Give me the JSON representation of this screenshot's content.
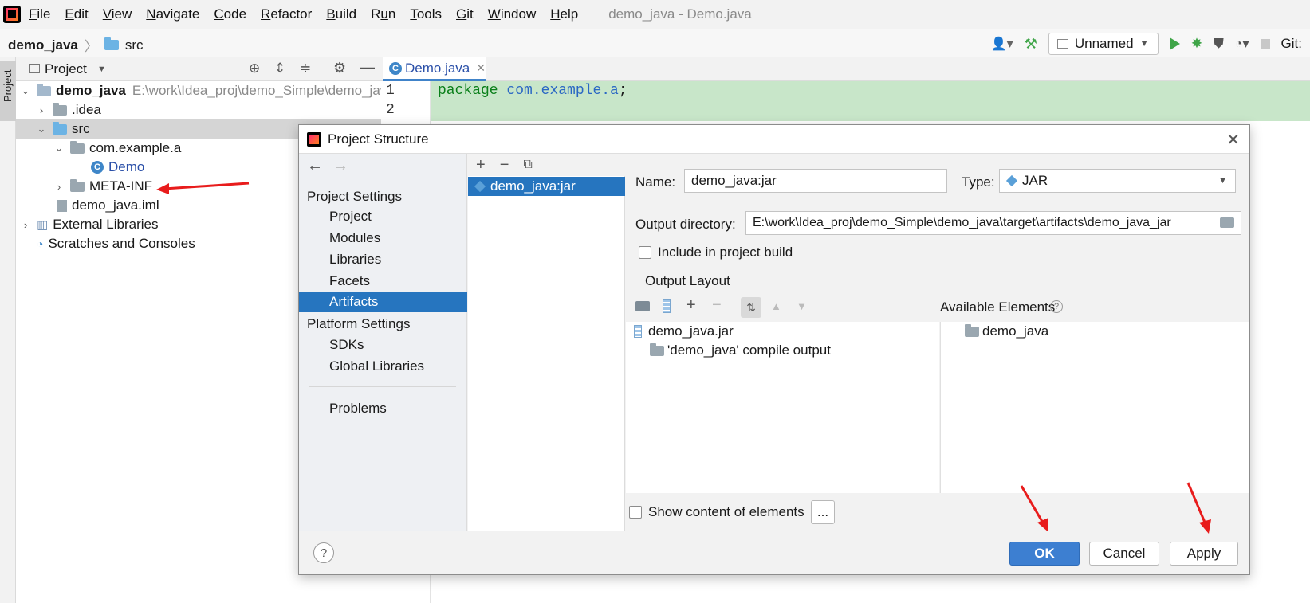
{
  "menubar": {
    "items": [
      {
        "label": "File",
        "ul": "F"
      },
      {
        "label": "Edit",
        "ul": "E"
      },
      {
        "label": "View",
        "ul": "V"
      },
      {
        "label": "Navigate",
        "ul": "N"
      },
      {
        "label": "Code",
        "ul": "C"
      },
      {
        "label": "Refactor",
        "ul": "R"
      },
      {
        "label": "Build",
        "ul": "B"
      },
      {
        "label": "Run",
        "ul": "u"
      },
      {
        "label": "Tools",
        "ul": "T"
      },
      {
        "label": "Git",
        "ul": "G"
      },
      {
        "label": "Window",
        "ul": "W"
      },
      {
        "label": "Help",
        "ul": "H"
      }
    ],
    "window_title": "demo_java - Demo.java"
  },
  "navbar": {
    "project": "demo_java",
    "folder": "src",
    "run_config": "Unnamed",
    "git_label": "Git:"
  },
  "side_stripe": {
    "label": "Project"
  },
  "project_panel": {
    "title": "Project",
    "tree": [
      {
        "label": "demo_java",
        "path": "E:\\work\\Idea_proj\\demo_Simple\\demo_java"
      },
      {
        "label": ".idea"
      },
      {
        "label": "src"
      },
      {
        "label": "com.example.a"
      },
      {
        "label": "Demo"
      },
      {
        "label": "META-INF"
      },
      {
        "label": "demo_java.iml"
      },
      {
        "label": "External Libraries"
      },
      {
        "label": "Scratches and Consoles"
      }
    ]
  },
  "editor": {
    "tab": "Demo.java",
    "line_numbers": [
      "1",
      "2"
    ],
    "line1_keyword": "package",
    "line1_package": "com.example.a",
    "line1_end": ";"
  },
  "dialog": {
    "title": "Project Structure",
    "nav": {
      "project_settings": "Project Settings",
      "project": "Project",
      "modules": "Modules",
      "libraries": "Libraries",
      "facets": "Facets",
      "artifacts": "Artifacts",
      "platform_settings": "Platform Settings",
      "sdks": "SDKs",
      "global_libraries": "Global Libraries",
      "problems": "Problems"
    },
    "artifact_item": "demo_java:jar",
    "form": {
      "name_label": "Name:",
      "name_value": "demo_java:jar",
      "type_label": "Type:",
      "type_value": "JAR",
      "output_dir_label": "Output directory:",
      "output_dir_value": "E:\\work\\Idea_proj\\demo_Simple\\demo_java\\target\\artifacts\\demo_java_jar",
      "include_build_label": "Include in project build",
      "output_layout_label": "Output Layout",
      "available_elements_label": "Available Elements",
      "layout_tree": [
        "demo_java.jar",
        "'demo_java' compile output"
      ],
      "available_tree": [
        "demo_java"
      ],
      "show_content_label": "Show content of elements",
      "more_button": "..."
    },
    "footer": {
      "help": "?",
      "ok": "OK",
      "cancel": "Cancel",
      "apply": "Apply"
    }
  },
  "colors": {
    "selection": "#2675bf",
    "primary_button": "#3d7fd1",
    "annotation_arrow": "#e81c1c",
    "code_highlight": "#c8e6c9"
  }
}
